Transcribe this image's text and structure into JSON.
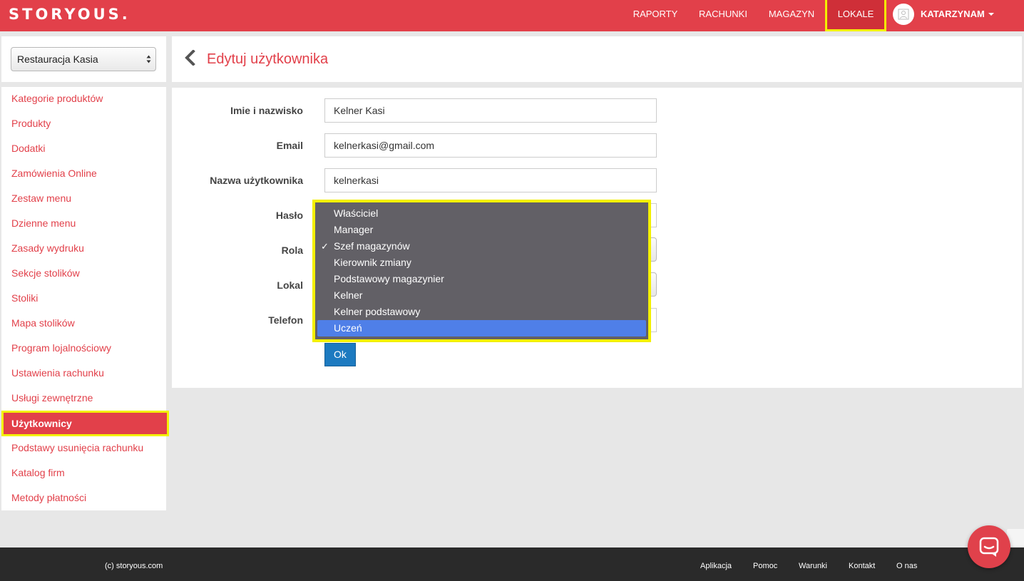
{
  "brand": {
    "logo": "STORYOUS.",
    "accent_color": "#e2404a",
    "highlight_color": "#f3f000"
  },
  "nav": {
    "items": [
      "RAPORTY",
      "RACHUNKI",
      "MAGAZYN",
      "LOKALE"
    ],
    "active": "LOKALE",
    "user_name": "KATARZYNAM"
  },
  "sidebar": {
    "venue": "Restauracja Kasia",
    "items": [
      "Kategorie produktów",
      "Produkty",
      "Dodatki",
      "Zamówienia Online",
      "Zestaw menu",
      "Dzienne menu",
      "Zasady wydruku",
      "Sekcje stolików",
      "Stoliki",
      "Mapa stolików",
      "Program lojalnościowy",
      "Ustawienia rachunku",
      "Usługi zewnętrzne",
      "Użytkownicy",
      "Podstawy usunięcia rachunku",
      "Katalog firm",
      "Metody płatności"
    ],
    "active": "Użytkownicy"
  },
  "page": {
    "title": "Edytuj użytkownika"
  },
  "form": {
    "name_label": "Imie i nazwisko",
    "name_value": "Kelner Kasi",
    "email_label": "Email",
    "email_value": "kelnerkasi@gmail.com",
    "username_label": "Nazwa użytkownika",
    "username_value": "kelnerkasi",
    "password_label": "Hasło",
    "role_label": "Rola",
    "venue_label": "Lokal",
    "phone_label": "Telefon",
    "submit_label": "Ok"
  },
  "role_dropdown": {
    "options": [
      "Właściciel",
      "Manager",
      "Szef magazynów",
      "Kierownik zmiany",
      "Podstawowy magazynier",
      "Kelner",
      "Kelner podstawowy",
      "Uczeń"
    ],
    "checked": "Szef magazynów",
    "highlighted": "Uczeń",
    "check_mark": "✓"
  },
  "footer": {
    "copyright": "(c) storyous.com",
    "links": [
      "Aplikacja",
      "Pomoc",
      "Warunki",
      "Kontakt",
      "O nas"
    ]
  },
  "icons": {
    "back": "chevron-left-icon",
    "avatar": "user-avatar-icon",
    "chat": "chat-bubble-icon"
  }
}
